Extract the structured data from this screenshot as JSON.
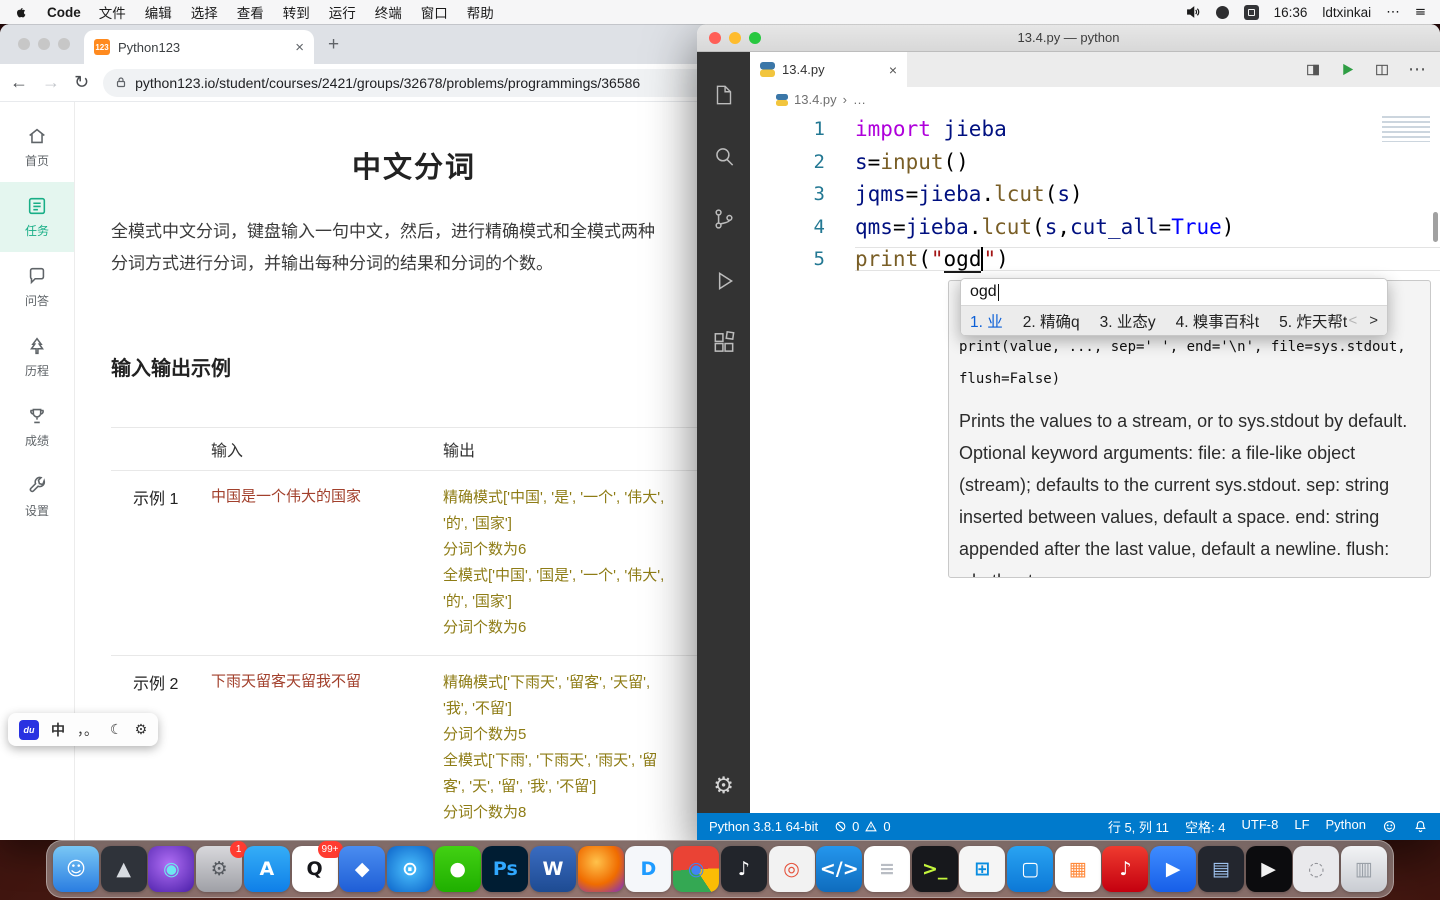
{
  "menubar": {
    "app_name": "Code",
    "menus": [
      "文件",
      "编辑",
      "选择",
      "查看",
      "转到",
      "运行",
      "终端",
      "窗口",
      "帮助"
    ],
    "time": "16:36",
    "user": "ldtxinkai",
    "icons": {
      "more": "⋯",
      "list": "≡"
    }
  },
  "browser": {
    "tab": {
      "title": "Python123",
      "favicon": "123"
    },
    "icons": {
      "close": "×",
      "new_tab": "+",
      "back": "←",
      "forward": "→",
      "refresh": "↻"
    },
    "url": "python123.io/student/courses/2421/groups/32678/problems/programmings/36586",
    "sidebar": {
      "items": [
        {
          "label": "首页"
        },
        {
          "label": "任务"
        },
        {
          "label": "问答"
        },
        {
          "label": "历程"
        },
        {
          "label": "成绩"
        },
        {
          "label": "设置"
        }
      ]
    },
    "page": {
      "title": "中文分词",
      "desc_lines": [
        "全模式中文分词，键盘输入一句中文，然后，进行精确模式和全模式两种",
        "分词方式进行分词，并输出每种分词的结果和分词的个数。"
      ],
      "section_title": "输入输出示例",
      "table": {
        "headers": {
          "input": "输入",
          "output": "输出"
        },
        "rows": [
          {
            "label": "示例 1",
            "input": "中国是一个伟大的国家",
            "output_lines": [
              "精确模式['中国', '是', '一个', '伟大',",
              "'的', '国家']",
              "分词个数为6",
              "全模式['中国', '国是', '一个', '伟大',",
              "'的', '国家']",
              "分词个数为6"
            ]
          },
          {
            "label": "示例 2",
            "input": "下雨天留客天留我不留",
            "output_lines": [
              "精确模式['下雨天', '留客', '天留',",
              "'我', '不留']",
              "分词个数为5",
              "全模式['下雨', '下雨天', '雨天', '留",
              "客', '天', '留', '我', '不留']",
              "分词个数为8"
            ]
          }
        ]
      }
    }
  },
  "ime_bar": {
    "logo": "du",
    "mode": "中",
    "punct": "，。",
    "moon": "☾",
    "gear": "⚙"
  },
  "vscode": {
    "window_title": "13.4.py — python",
    "tab": {
      "title": "13.4.py"
    },
    "icons": {
      "close": "×",
      "more": "⋯",
      "gear": "⚙"
    },
    "breadcrumb": {
      "file": "13.4.py",
      "sep": "›",
      "more": "…"
    },
    "code": {
      "lines": [
        {
          "num": "1",
          "tokens": [
            {
              "t": "import ",
              "c": "#AF00DB"
            },
            {
              "t": "jieba",
              "c": "#001080"
            }
          ]
        },
        {
          "num": "2",
          "tokens": [
            {
              "t": "s",
              "c": "#001080"
            },
            {
              "t": "=",
              "c": "#000000"
            },
            {
              "t": "input",
              "c": "#795E26"
            },
            {
              "t": "()",
              "c": "#000000"
            }
          ]
        },
        {
          "num": "3",
          "tokens": [
            {
              "t": "jqms",
              "c": "#001080"
            },
            {
              "t": "=",
              "c": "#000000"
            },
            {
              "t": "jieba",
              "c": "#001080"
            },
            {
              "t": ".",
              "c": "#000000"
            },
            {
              "t": "lcut",
              "c": "#795E26"
            },
            {
              "t": "(",
              "c": "#000000"
            },
            {
              "t": "s",
              "c": "#001080"
            },
            {
              "t": ")",
              "c": "#000000"
            }
          ]
        },
        {
          "num": "4",
          "tokens": [
            {
              "t": "qms",
              "c": "#001080"
            },
            {
              "t": "=",
              "c": "#000000"
            },
            {
              "t": "jieba",
              "c": "#001080"
            },
            {
              "t": ".",
              "c": "#000000"
            },
            {
              "t": "lcut",
              "c": "#795E26"
            },
            {
              "t": "(",
              "c": "#000000"
            },
            {
              "t": "s",
              "c": "#001080"
            },
            {
              "t": ",",
              "c": "#000000"
            },
            {
              "t": "cut_all",
              "c": "#001080"
            },
            {
              "t": "=",
              "c": "#000000"
            },
            {
              "t": "True",
              "c": "#0000FF"
            },
            {
              "t": ")",
              "c": "#000000"
            }
          ]
        },
        {
          "num": "5",
          "hl": "inset 0 1px 0 #e3e3e3, inset 0 -1px 0 #e3e3e3",
          "tokens": [
            {
              "t": "print",
              "c": "#795E26"
            },
            {
              "t": "(",
              "c": "#000000"
            },
            {
              "t": "\"",
              "c": "#A31515"
            },
            {
              "t": "ogd",
              "c": "#000000",
              "bb": "2px solid #1a1a1a"
            },
            {
              "t": "",
              "c": "#000000",
              "bl": "2px solid #000000"
            },
            {
              "t": "\"",
              "c": "#A31515"
            },
            {
              "t": ")",
              "c": "#000000"
            }
          ]
        }
      ]
    },
    "ime_popup": {
      "composition": "ogd",
      "candidates": [
        {
          "text": "1. 业",
          "color": "#0b5fd7"
        },
        {
          "text": "2. 精确q",
          "color": "#222222"
        },
        {
          "text": "3. 业态y",
          "color": "#222222"
        },
        {
          "text": "4. 糗事百科t",
          "color": "#222222"
        },
        {
          "text": "5. 炸天帮t",
          "color": "#222222"
        }
      ],
      "prev": "<",
      "next": ">"
    },
    "hover": {
      "signature": "print(value, ..., sep=' ', end='\\n', file=sys.stdout, flush=False)",
      "description": "Prints the values to a stream, or to sys.stdout by default. Optional keyword arguments: file: a file-like object (stream); defaults to the current sys.stdout. sep: string inserted between values, default a space. end: string appended after the last value, default a newline. flush: whether to"
    },
    "statusbar": {
      "python_version": "Python 3.8.1 64-bit",
      "errors": "0",
      "warnings": "0",
      "right_items": [
        "行 5, 列 11",
        "空格: 4",
        "UTF-8",
        "LF",
        "Python"
      ]
    }
  },
  "dock": {
    "items": [
      {
        "name": "dock-finder",
        "bg": "linear-gradient(180deg,#79c7f5,#2a7de1)",
        "glyph": "☺",
        "fg": "#ffffff"
      },
      {
        "name": "dock-launchpad",
        "bg": "#2f333a",
        "glyph": "▲",
        "fg": "#d8dce1"
      },
      {
        "name": "dock-siri",
        "bg": "radial-gradient(circle at 45% 40%,#b06ef5,#4a1fa8)",
        "glyph": "◉",
        "fg": "#6ee7f0"
      },
      {
        "name": "dock-system-preferences",
        "bg": "linear-gradient(180deg,#d8d8dc,#9fa0a6)",
        "glyph": "⚙",
        "fg": "#55595f",
        "badge": "1"
      },
      {
        "name": "dock-app-store",
        "bg": "linear-gradient(180deg,#35aef7,#0f7fe8)",
        "glyph": "A",
        "fg": "#ffffff"
      },
      {
        "name": "dock-qq",
        "bg": "#ffffff",
        "glyph": "Q",
        "fg": "#15161a",
        "badge": "99+"
      },
      {
        "name": "dock-design-tool",
        "bg": "linear-gradient(180deg,#4a8df0,#1f5ed6)",
        "glyph": "◆",
        "fg": "#ffffff"
      },
      {
        "name": "dock-safari",
        "bg": "radial-gradient(circle,#4cc2ff,#0c63c9)",
        "glyph": "⊙",
        "fg": "#ffffff"
      },
      {
        "name": "dock-wechat",
        "bg": "linear-gradient(180deg,#42d113,#1faf00)",
        "glyph": "●",
        "fg": "#ffffff"
      },
      {
        "name": "dock-photoshop",
        "bg": "#001d33",
        "glyph": "Ps",
        "fg": "#31a8ff"
      },
      {
        "name": "dock-word",
        "bg": "linear-gradient(180deg,#3a6cc1,#1e4b92)",
        "glyph": "W",
        "fg": "#ffffff"
      },
      {
        "name": "dock-firefox",
        "bg": "radial-gradient(circle at 40% 35%,#ffc24b,#f06c00 55%,#7a2ccc)",
        "glyph": "",
        "fg": "#ffffff"
      },
      {
        "name": "dock-dingtalk",
        "bg": "#f5f7fa",
        "glyph": "D",
        "fg": "#1e9bff"
      },
      {
        "name": "dock-chrome",
        "bg": "conic-gradient(from -30deg,#ea4335 0 33%,#fbbc05 33% 49%,#34a853 49% 82%,#ea4335 82%)",
        "glyph": "◉",
        "fg": "#4285f4"
      },
      {
        "name": "dock-music-app",
        "bg": "#22252b",
        "glyph": "♪",
        "fg": "#ffffff"
      },
      {
        "name": "dock-photos-app",
        "bg": "#f2f2f2",
        "glyph": "◎",
        "fg": "#e5533d"
      },
      {
        "name": "dock-vscode",
        "bg": "linear-gradient(180deg,#2496ed,#0f6cbd)",
        "glyph": "</>",
        "fg": "#ffffff"
      },
      {
        "name": "dock-notes-app",
        "bg": "#ffffff",
        "glyph": "≡",
        "fg": "#b9bdc4"
      },
      {
        "name": "dock-terminal-app",
        "bg": "#17181c",
        "glyph": ">_",
        "fg": "#c3f53c"
      },
      {
        "name": "dock-parallels-windows",
        "bg": "#f5f5f5",
        "glyph": "⊞",
        "fg": "#0a8de0"
      },
      {
        "name": "dock-remote-desktop",
        "bg": "linear-gradient(180deg,#29a3f2,#0c78d6)",
        "glyph": "▢",
        "fg": "#ffffff"
      },
      {
        "name": "dock-app-folder",
        "bg": "#ffffff",
        "glyph": "▦",
        "fg": "#ff8a3c"
      },
      {
        "name": "dock-netease-music",
        "bg": "linear-gradient(180deg,#ef3b2f,#c4000f)",
        "glyph": "♪",
        "fg": "#ffffff"
      },
      {
        "name": "dock-meeting-app",
        "bg": "linear-gradient(180deg,#3f8cff,#175fe8)",
        "glyph": "▶",
        "fg": "#ffffff"
      },
      {
        "name": "dock-keynote-app",
        "bg": "#23262e",
        "glyph": "▤",
        "fg": "#9fc3f0"
      },
      {
        "name": "dock-video-player",
        "bg": "#0c0c0e",
        "glyph": "▶",
        "fg": "#f1f1f1"
      },
      {
        "name": "dock-misc-app",
        "bg": "#e9e9ec",
        "glyph": "◌",
        "fg": "#8f9096"
      },
      {
        "name": "dock-trash",
        "bg": "linear-gradient(180deg,#f2f3f5,#c9ccd2)",
        "glyph": "▥",
        "fg": "#9aa0a8"
      }
    ]
  }
}
